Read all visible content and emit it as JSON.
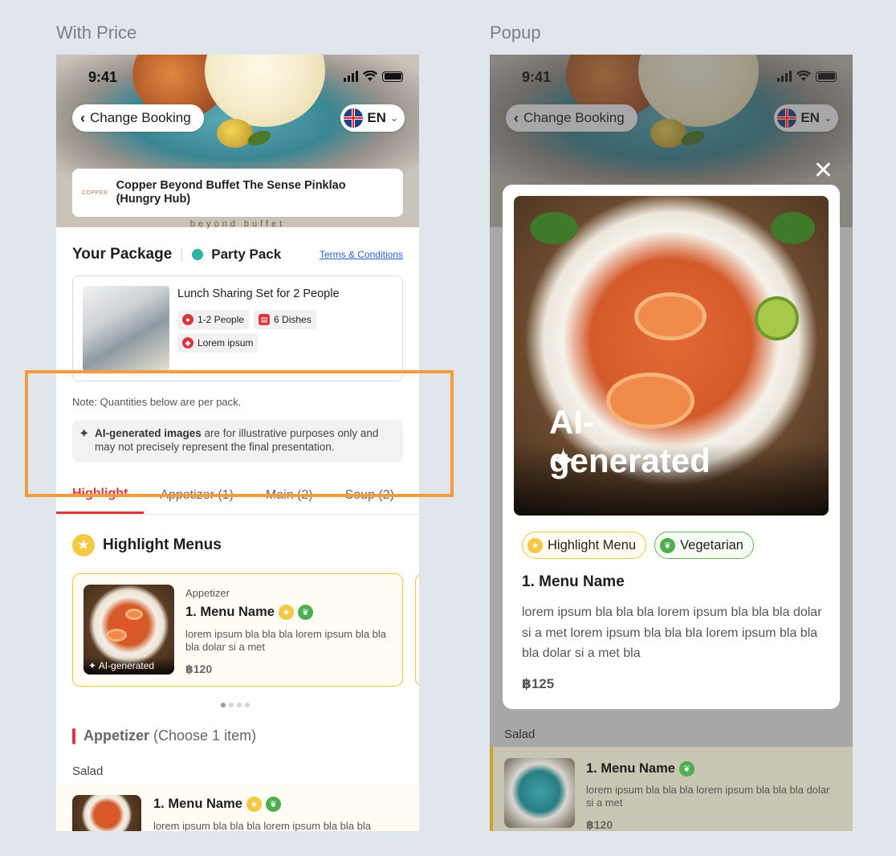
{
  "frames": {
    "left_title": "With Price",
    "right_title": "Popup"
  },
  "status": {
    "time": "9:41"
  },
  "nav": {
    "back_label": "Change Booking",
    "lang_label": "EN"
  },
  "venue": {
    "logo_text": "COPPER",
    "name": "Copper Beyond Buffet The Sense Pinklao (Hungry Hub)",
    "subtitle": "beyond buffet"
  },
  "package": {
    "heading": "Your Package",
    "type": "Party Pack",
    "terms": "Terms & Conditions",
    "set_title": "Lunch Sharing Set for 2 People",
    "chips": [
      "1-2 People",
      "6 Dishes",
      "Lorem ipsum"
    ]
  },
  "note": "Note: Quantities below are per pack.",
  "ai_notice": {
    "bold": "AI-generated images",
    "rest": " are for illustrative purposes only and may not precisely represent the final presentation."
  },
  "tabs": [
    "Highlight",
    "Appetizer (1)",
    "Main (2)",
    "Soup (2)"
  ],
  "highlight": {
    "heading": "Highlight Menus",
    "card": {
      "category": "Appetizer",
      "name": "1. Menu Name",
      "desc": "lorem ipsum bla bla bla lorem ipsum bla bla bla dolar si a met",
      "price": "฿120",
      "ai_tag": "✦ AI-generated"
    }
  },
  "appetizer": {
    "heading": "Appetizer",
    "sub": " (Choose 1 item)",
    "group": "Salad",
    "item": {
      "name": "1. Menu Name",
      "desc": "lorem ipsum bla bla bla lorem ipsum bla bla bla"
    }
  },
  "popup": {
    "ai_label": "AI-generated",
    "chips": [
      "Highlight Menu",
      "Vegetarian"
    ],
    "title": "1. Menu Name",
    "desc": "lorem ipsum bla bla bla lorem ipsum bla bla bla dolar si a met lorem ipsum bla bla bla lorem ipsum bla bla bla dolar si a met bla",
    "price": "฿125"
  },
  "right_list": {
    "group": "Salad",
    "item": {
      "name": "1. Menu Name",
      "desc": "lorem ipsum bla bla bla lorem ipsum bla bla bla dolar si a met",
      "price": "฿120"
    }
  },
  "colors": {
    "accent": "#d9363e",
    "highlight_border": "#f39c3d",
    "gold": "#f0c53a",
    "veg_green": "#4cae4f",
    "teal": "#2bb3a3"
  }
}
